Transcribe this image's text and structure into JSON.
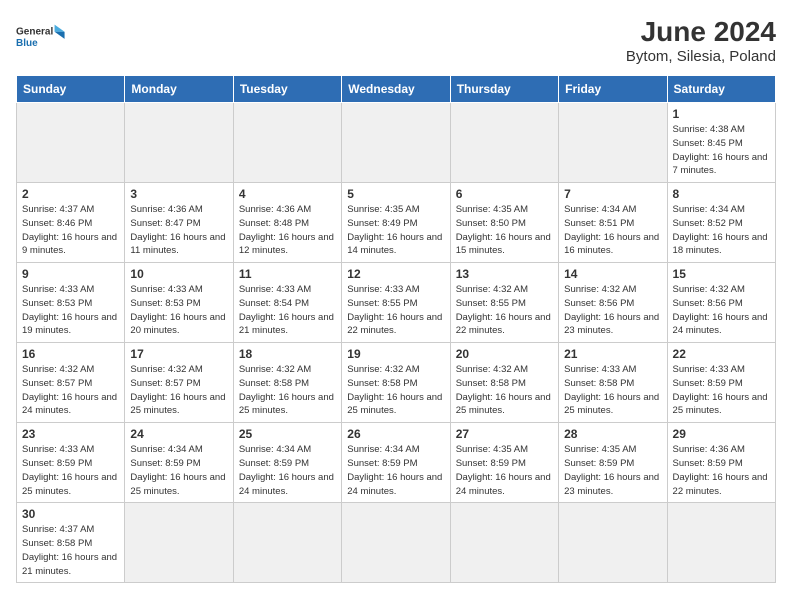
{
  "logo": {
    "text_general": "General",
    "text_blue": "Blue"
  },
  "header": {
    "month": "June 2024",
    "location": "Bytom, Silesia, Poland"
  },
  "weekdays": [
    "Sunday",
    "Monday",
    "Tuesday",
    "Wednesday",
    "Thursday",
    "Friday",
    "Saturday"
  ],
  "weeks": [
    [
      {
        "day": "",
        "info": ""
      },
      {
        "day": "",
        "info": ""
      },
      {
        "day": "",
        "info": ""
      },
      {
        "day": "",
        "info": ""
      },
      {
        "day": "",
        "info": ""
      },
      {
        "day": "",
        "info": ""
      },
      {
        "day": "1",
        "info": "Sunrise: 4:38 AM\nSunset: 8:45 PM\nDaylight: 16 hours and 7 minutes."
      }
    ],
    [
      {
        "day": "2",
        "info": "Sunrise: 4:37 AM\nSunset: 8:46 PM\nDaylight: 16 hours and 9 minutes."
      },
      {
        "day": "3",
        "info": "Sunrise: 4:36 AM\nSunset: 8:47 PM\nDaylight: 16 hours and 11 minutes."
      },
      {
        "day": "4",
        "info": "Sunrise: 4:36 AM\nSunset: 8:48 PM\nDaylight: 16 hours and 12 minutes."
      },
      {
        "day": "5",
        "info": "Sunrise: 4:35 AM\nSunset: 8:49 PM\nDaylight: 16 hours and 14 minutes."
      },
      {
        "day": "6",
        "info": "Sunrise: 4:35 AM\nSunset: 8:50 PM\nDaylight: 16 hours and 15 minutes."
      },
      {
        "day": "7",
        "info": "Sunrise: 4:34 AM\nSunset: 8:51 PM\nDaylight: 16 hours and 16 minutes."
      },
      {
        "day": "8",
        "info": "Sunrise: 4:34 AM\nSunset: 8:52 PM\nDaylight: 16 hours and 18 minutes."
      }
    ],
    [
      {
        "day": "9",
        "info": "Sunrise: 4:33 AM\nSunset: 8:53 PM\nDaylight: 16 hours and 19 minutes."
      },
      {
        "day": "10",
        "info": "Sunrise: 4:33 AM\nSunset: 8:53 PM\nDaylight: 16 hours and 20 minutes."
      },
      {
        "day": "11",
        "info": "Sunrise: 4:33 AM\nSunset: 8:54 PM\nDaylight: 16 hours and 21 minutes."
      },
      {
        "day": "12",
        "info": "Sunrise: 4:33 AM\nSunset: 8:55 PM\nDaylight: 16 hours and 22 minutes."
      },
      {
        "day": "13",
        "info": "Sunrise: 4:32 AM\nSunset: 8:55 PM\nDaylight: 16 hours and 22 minutes."
      },
      {
        "day": "14",
        "info": "Sunrise: 4:32 AM\nSunset: 8:56 PM\nDaylight: 16 hours and 23 minutes."
      },
      {
        "day": "15",
        "info": "Sunrise: 4:32 AM\nSunset: 8:56 PM\nDaylight: 16 hours and 24 minutes."
      }
    ],
    [
      {
        "day": "16",
        "info": "Sunrise: 4:32 AM\nSunset: 8:57 PM\nDaylight: 16 hours and 24 minutes."
      },
      {
        "day": "17",
        "info": "Sunrise: 4:32 AM\nSunset: 8:57 PM\nDaylight: 16 hours and 25 minutes."
      },
      {
        "day": "18",
        "info": "Sunrise: 4:32 AM\nSunset: 8:58 PM\nDaylight: 16 hours and 25 minutes."
      },
      {
        "day": "19",
        "info": "Sunrise: 4:32 AM\nSunset: 8:58 PM\nDaylight: 16 hours and 25 minutes."
      },
      {
        "day": "20",
        "info": "Sunrise: 4:32 AM\nSunset: 8:58 PM\nDaylight: 16 hours and 25 minutes."
      },
      {
        "day": "21",
        "info": "Sunrise: 4:33 AM\nSunset: 8:58 PM\nDaylight: 16 hours and 25 minutes."
      },
      {
        "day": "22",
        "info": "Sunrise: 4:33 AM\nSunset: 8:59 PM\nDaylight: 16 hours and 25 minutes."
      }
    ],
    [
      {
        "day": "23",
        "info": "Sunrise: 4:33 AM\nSunset: 8:59 PM\nDaylight: 16 hours and 25 minutes."
      },
      {
        "day": "24",
        "info": "Sunrise: 4:34 AM\nSunset: 8:59 PM\nDaylight: 16 hours and 25 minutes."
      },
      {
        "day": "25",
        "info": "Sunrise: 4:34 AM\nSunset: 8:59 PM\nDaylight: 16 hours and 24 minutes."
      },
      {
        "day": "26",
        "info": "Sunrise: 4:34 AM\nSunset: 8:59 PM\nDaylight: 16 hours and 24 minutes."
      },
      {
        "day": "27",
        "info": "Sunrise: 4:35 AM\nSunset: 8:59 PM\nDaylight: 16 hours and 24 minutes."
      },
      {
        "day": "28",
        "info": "Sunrise: 4:35 AM\nSunset: 8:59 PM\nDaylight: 16 hours and 23 minutes."
      },
      {
        "day": "29",
        "info": "Sunrise: 4:36 AM\nSunset: 8:59 PM\nDaylight: 16 hours and 22 minutes."
      }
    ],
    [
      {
        "day": "30",
        "info": "Sunrise: 4:37 AM\nSunset: 8:58 PM\nDaylight: 16 hours and 21 minutes."
      },
      {
        "day": "",
        "info": ""
      },
      {
        "day": "",
        "info": ""
      },
      {
        "day": "",
        "info": ""
      },
      {
        "day": "",
        "info": ""
      },
      {
        "day": "",
        "info": ""
      },
      {
        "day": "",
        "info": ""
      }
    ]
  ]
}
